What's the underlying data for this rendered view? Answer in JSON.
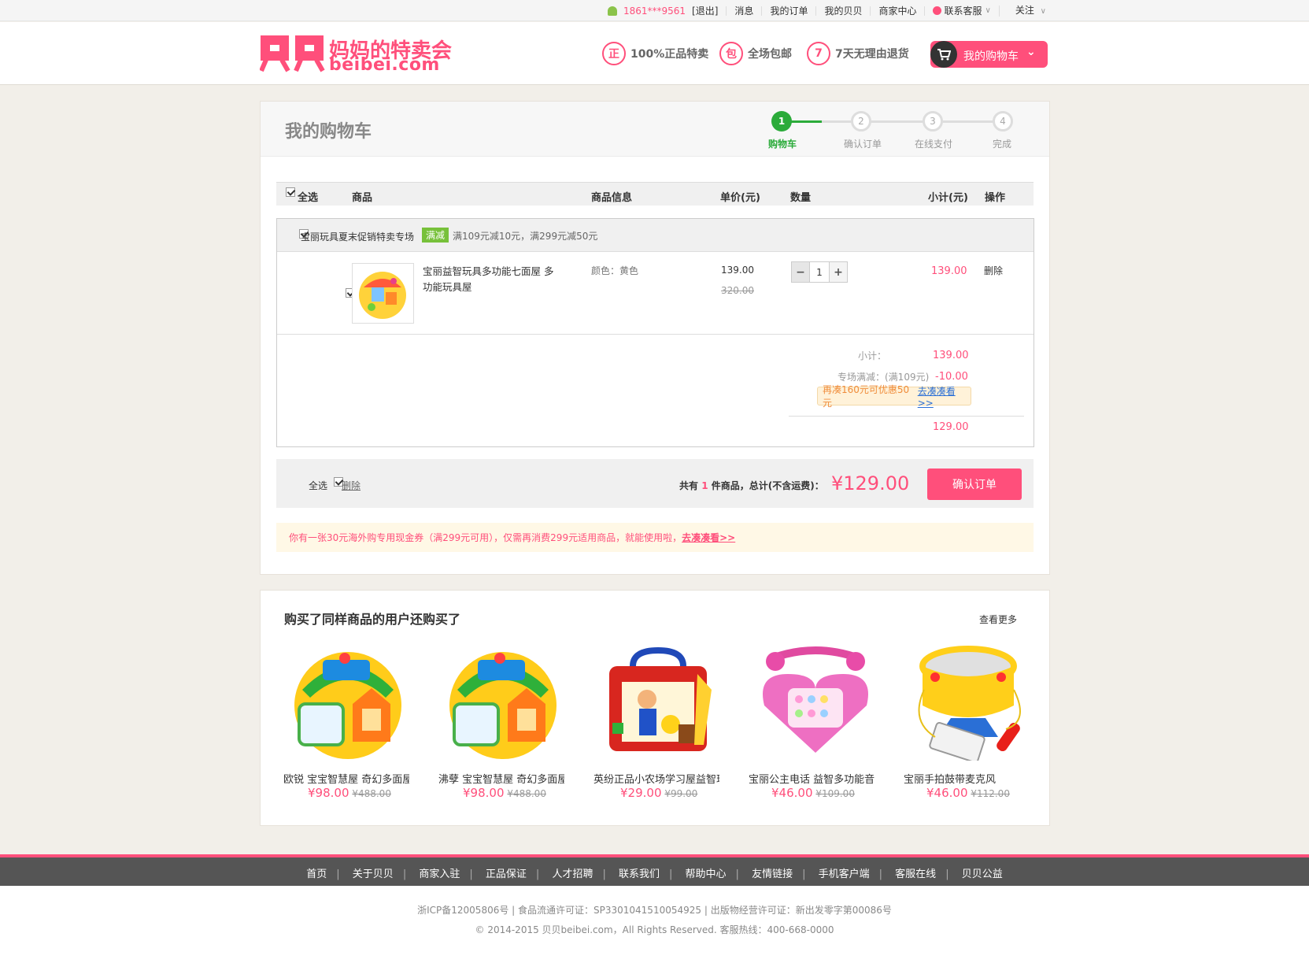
{
  "topbar": {
    "user": "1861***9561",
    "logout": "[退出]",
    "messages": "消息",
    "my_orders": "我的订单",
    "my_beibei": "我的贝贝",
    "merchant": "商家中心",
    "support": "联系客服",
    "follow": "关注"
  },
  "header": {
    "logo_text": "妈妈的特卖会",
    "logo_url": "beibei.com",
    "promises": [
      {
        "icon": "正",
        "text": "100%正品特卖"
      },
      {
        "icon": "包",
        "text": "全场包邮"
      },
      {
        "icon": "7",
        "text": "7天无理由退货"
      }
    ],
    "cart_button": "我的购物车"
  },
  "cart": {
    "title": "我的购物车",
    "steps": [
      {
        "num": "1",
        "label": "购物车"
      },
      {
        "num": "2",
        "label": "确认订单"
      },
      {
        "num": "3",
        "label": "在线支付"
      },
      {
        "num": "4",
        "label": "完成"
      }
    ],
    "columns": {
      "select_all": "全选",
      "product": "商品",
      "info": "商品信息",
      "price": "单价(元)",
      "qty": "数量",
      "subtotal": "小计(元)",
      "action": "操作"
    },
    "store": {
      "name": "宝丽玩具夏末促销特卖专场",
      "badge": "满减",
      "promo": "满109元减10元，满299元减50元"
    },
    "item": {
      "name": "宝丽益智玩具多功能七面屋 多功能玩具屋",
      "attr": "颜色：黄色",
      "price": "139.00",
      "orig_price": "320.00",
      "qty": "1",
      "subtotal": "139.00",
      "delete": "删除"
    },
    "summary": {
      "subtotal_label": "小计：",
      "subtotal": "139.00",
      "discount_label": "专场满减：(满109元)",
      "discount": "-10.00",
      "tip": "再凑160元可优惠50元",
      "tip_link": "去凑凑看>>",
      "total": "129.00"
    },
    "bottom": {
      "select_all": "全选",
      "delete": "删除",
      "count_prefix": "共有",
      "count": "1",
      "count_suffix": "件商品，总计(不含运费)：",
      "total": "¥129.00",
      "confirm": "确认订单"
    },
    "coupon": {
      "text": "你有一张30元海外购专用现金券（满299元可用），仅需再消费299元适用商品，就能使用啦，",
      "link": "去凑凑看>>"
    }
  },
  "recommend": {
    "title": "购买了同样商品的用户还购买了",
    "more": "查看更多",
    "products": [
      {
        "name": "欧锐 宝宝智慧屋 奇幻多面屋",
        "price": "¥98.00",
        "orig": "¥488.00"
      },
      {
        "name": "沸孽 宝宝智慧屋 奇幻多面屋",
        "price": "¥98.00",
        "orig": "¥488.00"
      },
      {
        "name": "英纷正品小农场学习屋益智玩",
        "price": "¥29.00",
        "orig": "¥99.00"
      },
      {
        "name": "宝丽公主电话 益智多功能音乐",
        "price": "¥46.00",
        "orig": "¥109.00"
      },
      {
        "name": "宝丽手拍鼓带麦克风",
        "price": "¥46.00",
        "orig": "¥112.00"
      }
    ]
  },
  "footer": {
    "links": [
      "首页",
      "关于贝贝",
      "商家入驻",
      "正品保证",
      "人才招聘",
      "联系我们",
      "帮助中心",
      "友情链接",
      "手机客户端",
      "客服在线",
      "贝贝公益"
    ],
    "icp": "浙ICP备12005806号 | 食品流通许可证：SP3301041510054925 | 出版物经营许可证：新出发零字第00086号",
    "copyright": "© 2014-2015 贝贝beibei.com，All Rights Reserved. 客服热线：400-668-0000"
  },
  "colors": {
    "accent": "#ff4f7b",
    "green": "#2bab3a",
    "badge": "#77c13a"
  }
}
